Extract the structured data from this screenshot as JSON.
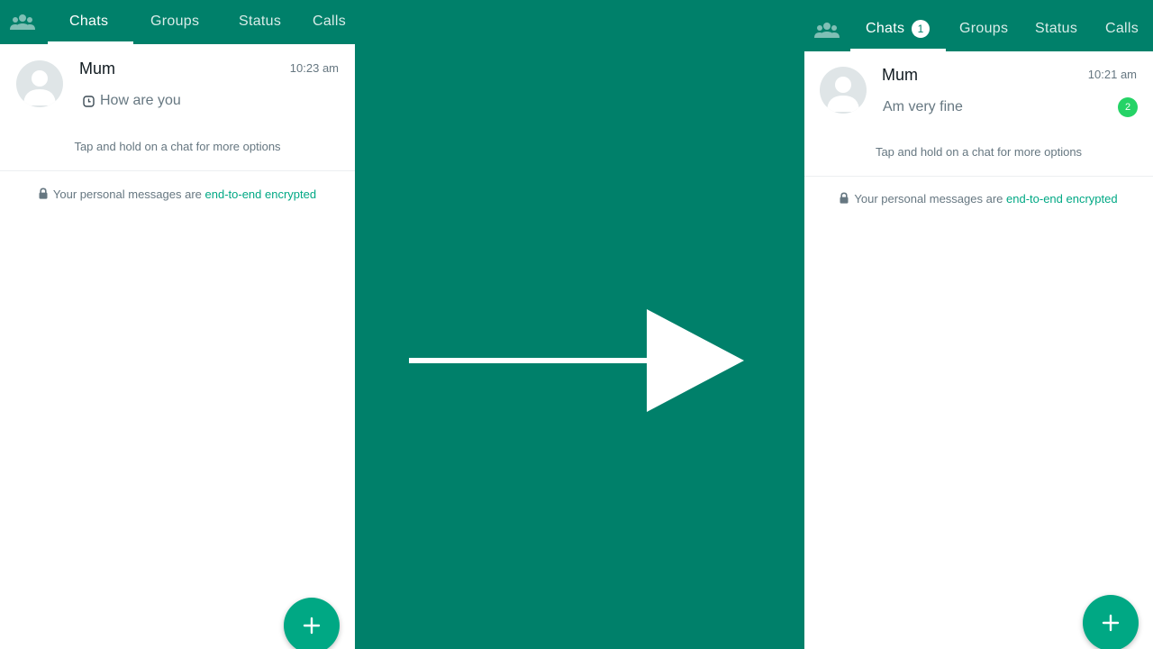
{
  "colors": {
    "header": "#00806a",
    "accent": "#00a884",
    "unread": "#25d366"
  },
  "left": {
    "tabs": {
      "chats": "Chats",
      "groups": "Groups",
      "status": "Status",
      "calls": "Calls"
    },
    "chat": {
      "name": "Mum",
      "time": "10:23 am",
      "preview": "How are you",
      "preview_icon": "clock-icon"
    },
    "hint": "Tap and hold on a chat for more options",
    "encrypted": {
      "text": "Your personal messages are ",
      "link": "end-to-end encrypted"
    }
  },
  "right": {
    "tabs": {
      "chats": "Chats",
      "chats_badge": "1",
      "groups": "Groups",
      "status": "Status",
      "calls": "Calls"
    },
    "chat": {
      "name": "Mum",
      "time": "10:21 am",
      "preview": "Am very fine",
      "unread_count": "2"
    },
    "hint": "Tap and hold on a chat for more options",
    "encrypted": {
      "text": "Your personal messages are ",
      "link": "end-to-end encrypted"
    }
  },
  "icons": [
    "community-icon",
    "clock-icon",
    "lock-icon",
    "plus-icon",
    "arrow-right-icon",
    "avatar-placeholder-icon"
  ]
}
